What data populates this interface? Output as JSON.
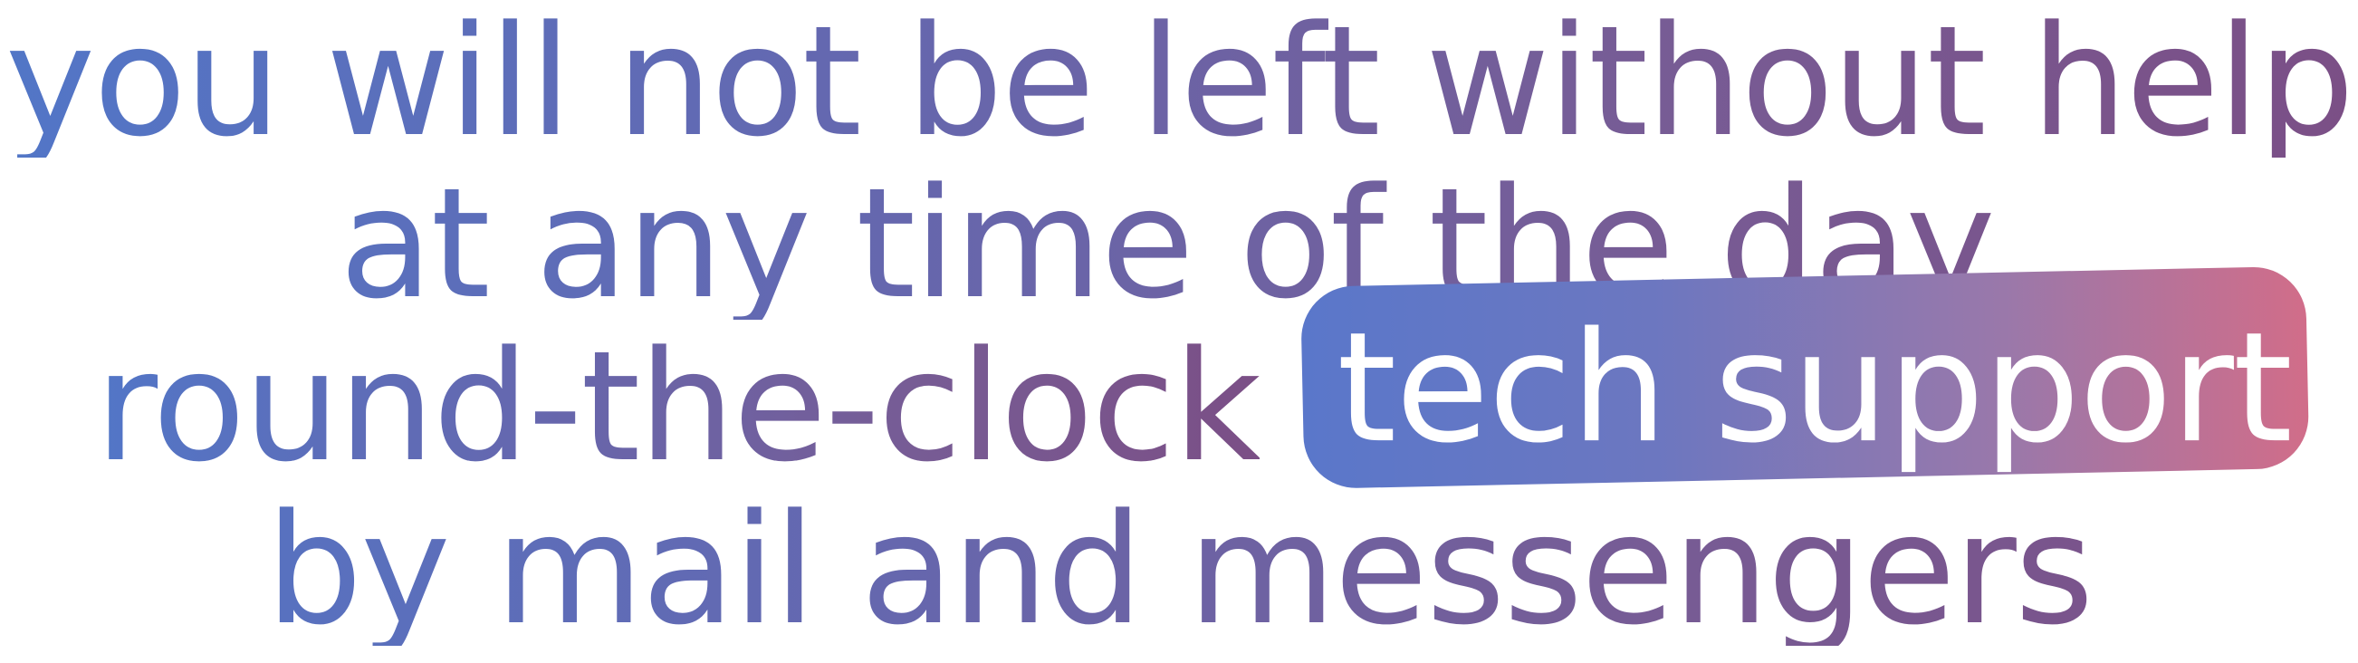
{
  "headline": {
    "line1": "you will not be left without help",
    "line2": "at any time of the day.",
    "line3": "round-the-clock",
    "highlight": "tech support",
    "line4": "by mail and messengers"
  },
  "colors": {
    "text_gradient_start": "#5276c7",
    "text_gradient_end": "#7b4f86",
    "pill_gradient_start": "#5a77ca",
    "pill_gradient_end": "#d16d89",
    "pill_text": "#ffffff",
    "background": "#ffffff"
  }
}
